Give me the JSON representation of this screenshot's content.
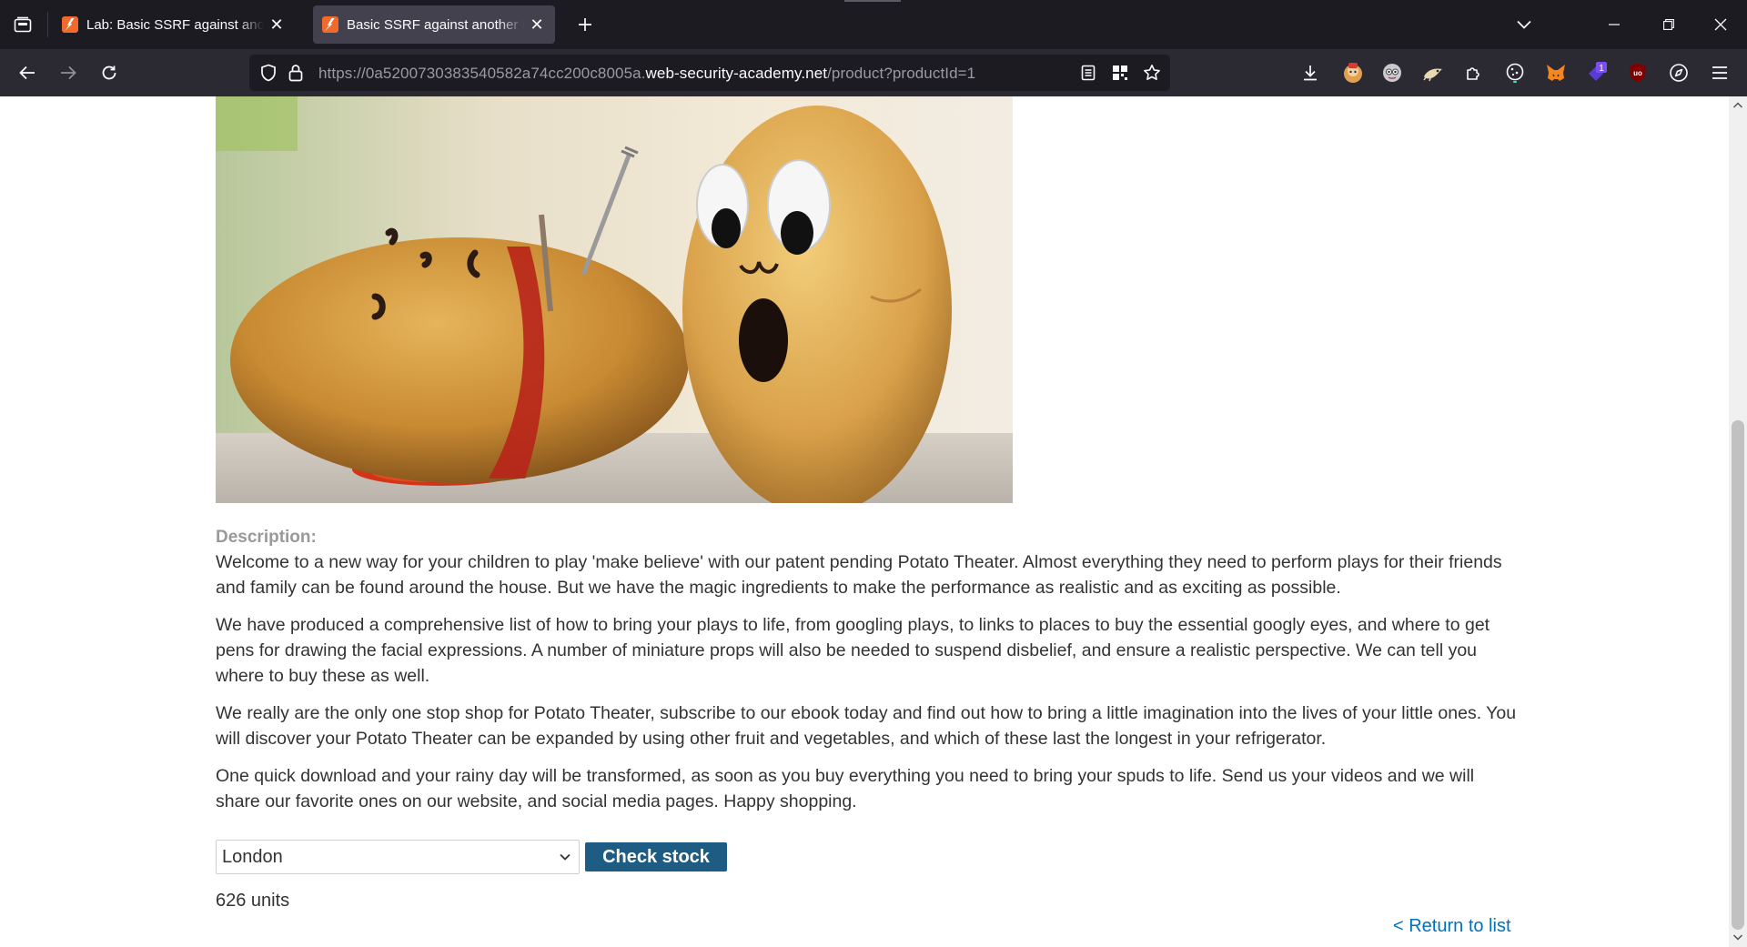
{
  "browser": {
    "tabs": [
      {
        "title": "Lab: Basic SSRF against another back-end system | Web Security Academy",
        "active": false
      },
      {
        "title": "Basic SSRF against another back-end system",
        "active": true
      }
    ],
    "url": {
      "prefix": "https://0a5200730383540582a74cc200c8005a.",
      "domain": "web-security-academy.net",
      "path": "/product?productId=1"
    },
    "extensions": [
      "download-icon",
      "ublock-shield-icon",
      "avatar-extension-icon",
      "dino-extension-icon",
      "extensions-puzzle-icon",
      "cookie-icon",
      "metamask-fox-icon",
      "purple-badge-extension-icon",
      "ublock-origin-icon",
      "compass-icon",
      "menu-icon"
    ],
    "extension_badge": "1",
    "ublock_label": "uo"
  },
  "product": {
    "image_alt": "Potato Theater product image",
    "description_label": "Description:",
    "paragraphs": [
      "Welcome to a new way for your children to play 'make believe' with our patent pending Potato Theater. Almost everything they need to perform plays for their friends and family can be found around the house. But we have the magic ingredients to make the performance as realistic and as exciting as possible.",
      "We have produced a comprehensive list of how to bring your plays to life, from googling plays, to links to places to buy the essential googly eyes, and where to get pens for drawing the facial expressions. A number of miniature props will also be needed to suspend disbelief, and ensure a realistic perspective. We can tell you where to buy these as well.",
      "We really are the only one stop shop for Potato Theater, subscribe to our ebook today and find out how to bring a little imagination into the lives of your little ones. You will discover your Potato Theater can be expanded by using other fruit and vegetables, and which of these last the longest in your refrigerator.",
      "One quick download and your rainy day will be transformed, as soon as you buy everything you need to bring your spuds to life. Send us your videos and we will share our favorite ones on our website, and social media pages. Happy shopping."
    ],
    "store_select": {
      "selected": "London"
    },
    "check_stock_label": "Check stock",
    "stock_result": "626 units",
    "return_link": "< Return to list"
  },
  "colors": {
    "accent_button": "#1e5c84",
    "link": "#0071bc",
    "favicon": "#f26a2b"
  }
}
